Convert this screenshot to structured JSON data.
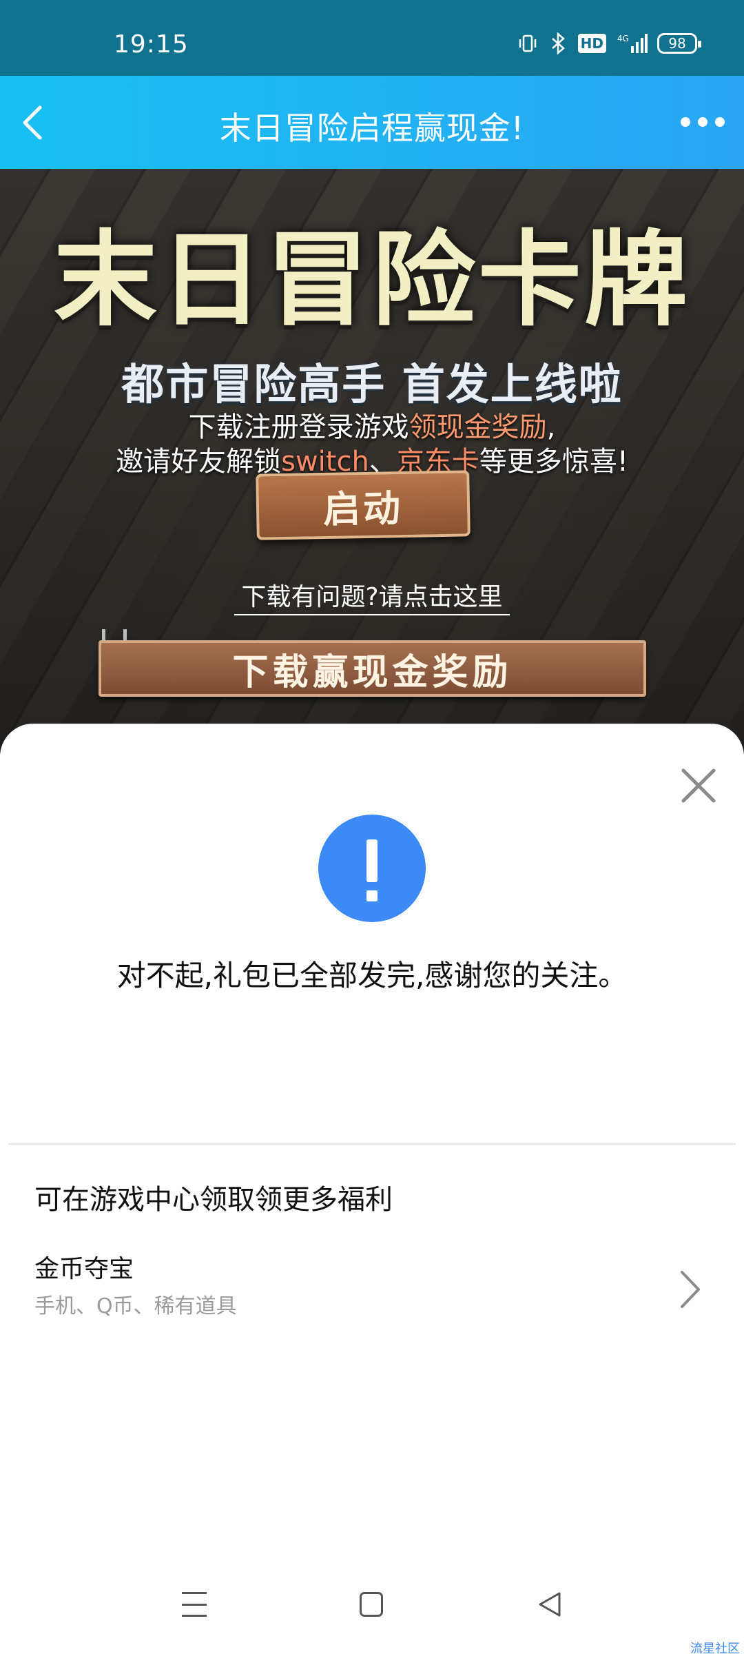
{
  "status_bar": {
    "time": "19:15",
    "hd": "HD",
    "network": "4G",
    "battery": "98",
    "icons": [
      "vibrate-icon",
      "bluetooth-icon",
      "hd-icon",
      "signal-4g-icon",
      "battery-icon"
    ]
  },
  "nav": {
    "title": "末日冒险启程赢现金!",
    "icons": [
      "back-icon",
      "more-icon"
    ]
  },
  "banner": {
    "title": "末日冒险卡牌",
    "subtitle": "都市冒险高手 首发上线啦",
    "line1_prefix": "下载注册登录游戏",
    "line1_highlight": "领现金奖励",
    "line1_suffix": ",",
    "line2_prefix": "邀请好友解锁",
    "line2_highlight1": "switch",
    "line2_sep": "、",
    "line2_highlight2": "京东卡",
    "line2_suffix": "等更多惊喜!",
    "start_button": "启动",
    "help_link": "下载有问题?请点击这里",
    "download_button": "下载赢现金奖励"
  },
  "sheet": {
    "message": "对不起,礼包已全部发完,感谢您的关注。",
    "section_title": "可在游戏中心领取领更多福利",
    "item": {
      "title": "金币夺宝",
      "subtitle": "手机、Q币、稀有道具"
    },
    "colors": {
      "alert": "#3d8af7"
    }
  },
  "watermark": "流星社区",
  "colors": {
    "status_bar": "#11728f",
    "nav_start": "#18c0f2",
    "nav_end": "#2aa6f3"
  }
}
